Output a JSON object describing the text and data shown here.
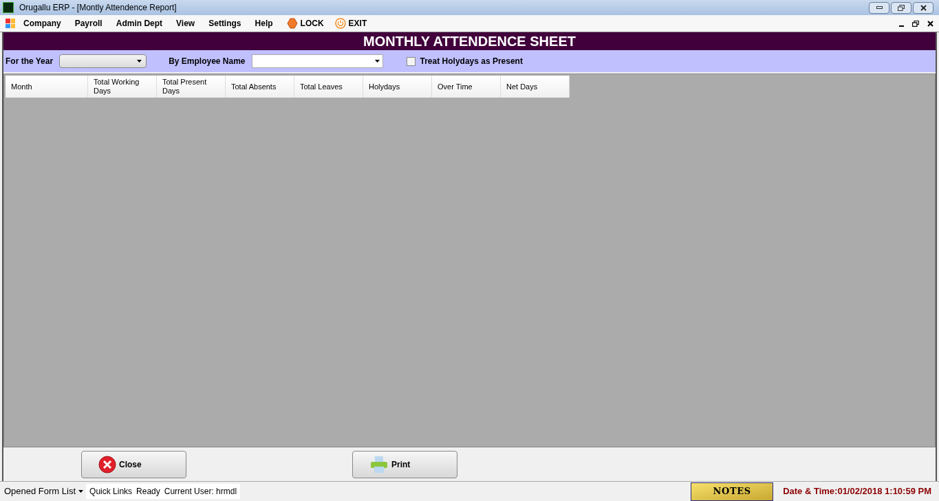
{
  "window": {
    "title": "Orugallu ERP - [Montly Attendence Report]"
  },
  "menu": [
    {
      "label": "Company"
    },
    {
      "label": "Payroll"
    },
    {
      "label": "Admin Dept"
    },
    {
      "label": "View"
    },
    {
      "label": "Settings"
    },
    {
      "label": "Help"
    },
    {
      "label": "LOCK",
      "kind": "lock"
    },
    {
      "label": "EXIT",
      "kind": "exit"
    }
  ],
  "header": "MONTHLY ATTENDENCE SHEET",
  "filters": {
    "year_label": "For the Year",
    "employee_label": "By Employee Name",
    "treat_holidays": {
      "label": "Treat Holydays as Present",
      "checked": false
    }
  },
  "table": {
    "columns": [
      {
        "label": "Month"
      },
      {
        "label": "Total Working Days"
      },
      {
        "label": "Total Present Days"
      },
      {
        "label": "Total Absents"
      },
      {
        "label": "Total Leaves"
      },
      {
        "label": "Holydays"
      },
      {
        "label": "Over Time"
      },
      {
        "label": "Net Days"
      }
    ]
  },
  "buttons": [
    {
      "label": "Close",
      "kind": "close"
    },
    {
      "label": "Print",
      "kind": "print"
    }
  ],
  "status_bar": {
    "opened_forms": "Opened Form List",
    "quick_links": "Quick Links",
    "status": "Ready",
    "user": "Current User: hrmdl",
    "notes": "NOTES",
    "datetime": "Date & Time:01/02/2018 1:10:59 PM"
  }
}
